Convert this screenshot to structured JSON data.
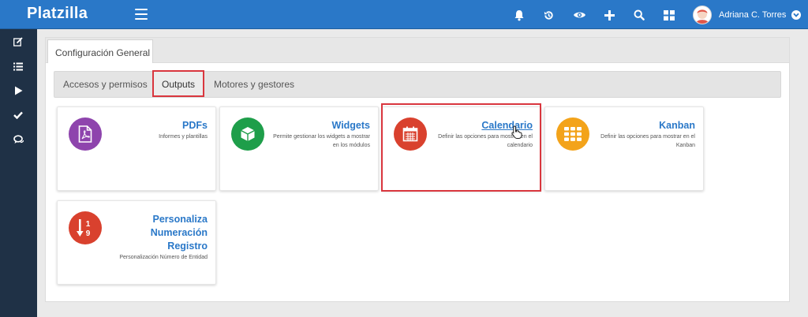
{
  "app": {
    "title": "Platzilla"
  },
  "user": {
    "name": "Adriana C. Torres"
  },
  "topbar": {
    "icons": [
      "bell-icon",
      "history-icon",
      "eye-icon",
      "plus-icon",
      "search-icon",
      "grid-icon"
    ]
  },
  "sidebar": {
    "icons": [
      "edit-icon",
      "list-icon",
      "play-icon",
      "check-icon",
      "chat-icon"
    ]
  },
  "panel": {
    "tab": "Configuración General"
  },
  "subtabs": [
    {
      "label": "Accesos y permisos",
      "active": false
    },
    {
      "label": "Outputs",
      "active": true
    },
    {
      "label": "Motores y gestores",
      "active": false
    }
  ],
  "cards": [
    {
      "title": "PDFs",
      "desc": "Informes y plantillas",
      "icon": "pdf-icon",
      "color": "#8e44ad"
    },
    {
      "title": "Widgets",
      "desc": "Permite gestionar los widgets a mostrar en los módulos",
      "icon": "cube-icon",
      "color": "#1e9e4a"
    },
    {
      "title": "Calendario",
      "desc": "Definir las opciones para mostrar en el calendario",
      "icon": "calendar-icon",
      "color": "#d9412e"
    },
    {
      "title": "Kanban",
      "desc": "Definir las opciones para mostrar en el Kanban",
      "icon": "kanban-icon",
      "color": "#f3a31a"
    },
    {
      "title": "Personaliza Numeración Registro",
      "desc": "Personalización Número de Entidad",
      "icon": "sort-numeric-icon",
      "color": "#d9412e"
    }
  ],
  "colors": {
    "topbar": "#2a78c8",
    "sidebar": "#1f3146",
    "link": "#2a78c8",
    "highlight": "#d9363e"
  }
}
